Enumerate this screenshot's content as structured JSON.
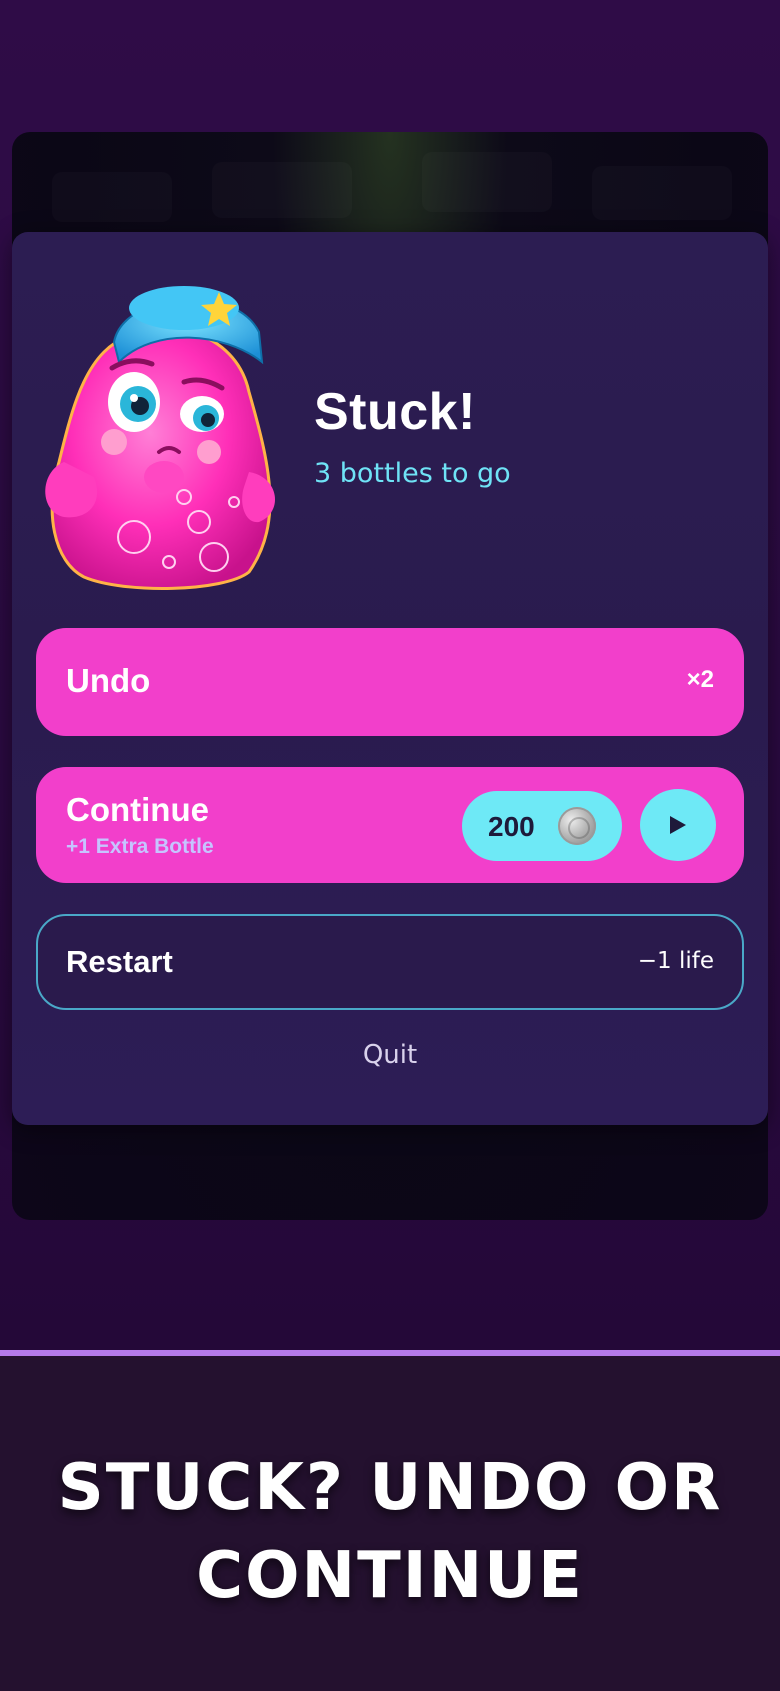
{
  "dialog": {
    "title": "Stuck!",
    "subtitle": "3 bottles to go",
    "mascot_icon": "pink-jelly-mascot-icon"
  },
  "undo": {
    "label": "Undo",
    "count": "×2"
  },
  "continue": {
    "label": "Continue",
    "sublabel": "+1 Extra Bottle",
    "price": "200",
    "coin_icon": "coin-icon",
    "play_icon": "play-ad-icon"
  },
  "restart": {
    "label": "Restart",
    "cost": "−1 life"
  },
  "quit": {
    "label": "Quit"
  },
  "caption": {
    "line1": "STUCK? UNDO OR",
    "line2": "CONTINUE"
  },
  "colors": {
    "accent_pink": "#f23fcb",
    "accent_cyan": "#6ee9f6",
    "modal_bg": "#2c1d52",
    "divider": "#b57ae9"
  }
}
